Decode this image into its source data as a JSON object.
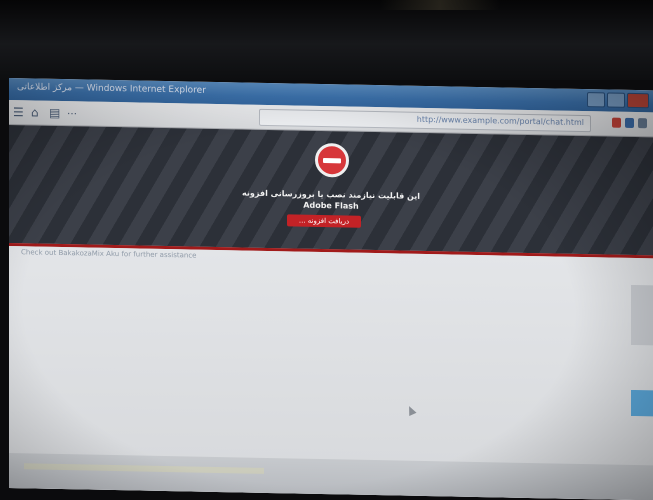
{
  "window": {
    "title": "مرکز اطلاعاتی — Windows Internet Explorer"
  },
  "browser": {
    "address": "http://www.example.com/portal/chat.html"
  },
  "banner": {
    "message_line1": "این قابلیت نیازمند نصب یا بروزرسانی افزونه",
    "message_line2": "Adobe Flash",
    "button_label": "دریافت افزونه ..."
  },
  "content": {
    "fallback_text": "Check out BakakozaMix Aku for further assistance"
  },
  "colors": {
    "banner_bg": "#2c3038",
    "accent_red": "#c32226",
    "titlebar_blue": "#3e76b3"
  }
}
